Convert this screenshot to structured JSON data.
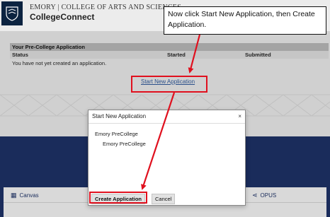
{
  "header": {
    "school": "EMORY | COLLEGE OF ARTS AND SCIENCES",
    "app_name": "CollegeConnect",
    "brand_color": "#0c2340"
  },
  "table": {
    "title": "Your Pre-College Application",
    "columns": [
      "Status",
      "Started",
      "Submitted"
    ],
    "empty_message": "You have not yet created an application."
  },
  "start_link": "Start New Application",
  "modal": {
    "title": "Start New Application",
    "close": "×",
    "options": [
      "Emory PreCollege",
      "Emory PreCollege"
    ],
    "create_button": "Create Application",
    "cancel_button": "Cancel"
  },
  "tiles": [
    {
      "label": "Canvas",
      "icon": "calendar-icon"
    },
    {
      "label": "OPUS",
      "icon": "share-icon"
    }
  ],
  "annotation": {
    "text": "Now click Start New Application, then Create Application.",
    "highlight_color": "#e0101e"
  },
  "band_color": "#1a2c5b"
}
